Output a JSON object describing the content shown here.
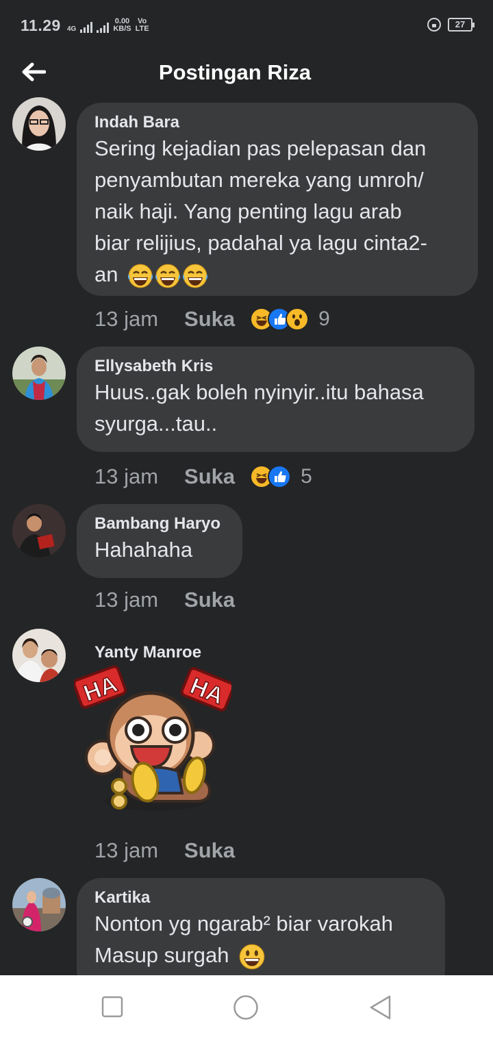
{
  "status": {
    "time": "11.29",
    "net_type": "4G",
    "speed_value": "0.00",
    "speed_unit": "KB/S",
    "volte_top": "Vo",
    "volte_bottom": "LTE",
    "battery": "27"
  },
  "header": {
    "title": "Postingan Riza"
  },
  "comments": [
    {
      "author": "Indah Bara",
      "lines": [
        "Sering kejadian pas pelepasan dan",
        "penyambutan mereka yang umroh/",
        "naik haji. Yang penting lagu arab",
        "biar relijius, padahal ya lagu cinta2-",
        "an"
      ],
      "time": "13 jam",
      "like": "Suka",
      "reaction_count": "9"
    },
    {
      "author": "Ellysabeth Kris",
      "lines": [
        "Huus..gak boleh nyinyir..itu bahasa",
        "syurga...tau.."
      ],
      "time": "13 jam",
      "like": "Suka",
      "reaction_count": "5"
    },
    {
      "author": "Bambang Haryo",
      "lines": [
        "Hahahaha"
      ],
      "time": "13 jam",
      "like": "Suka"
    },
    {
      "author": "Yanty Manroe",
      "sticker_text_left": "HA",
      "sticker_text_right": "HA",
      "time": "13 jam",
      "like": "Suka"
    },
    {
      "author": "Kartika",
      "lines": [
        "Nonton yg ngarab² biar varokah",
        "Masup surgah"
      ]
    }
  ],
  "icons": {
    "back": "arrow-left-icon",
    "reaction_haha": "haha-reaction-icon",
    "reaction_like": "like-reaction-icon",
    "reaction_wow": "wow-reaction-icon",
    "nav_recents": "square-icon",
    "nav_home": "circle-icon",
    "nav_back": "triangle-back-icon"
  },
  "colors": {
    "background": "#242526",
    "bubble": "#3a3b3c",
    "text": "#e4e6eb",
    "meta": "#a0a3a8",
    "like_blue": "#1877f2",
    "haha_yellow": "#f7b928"
  }
}
